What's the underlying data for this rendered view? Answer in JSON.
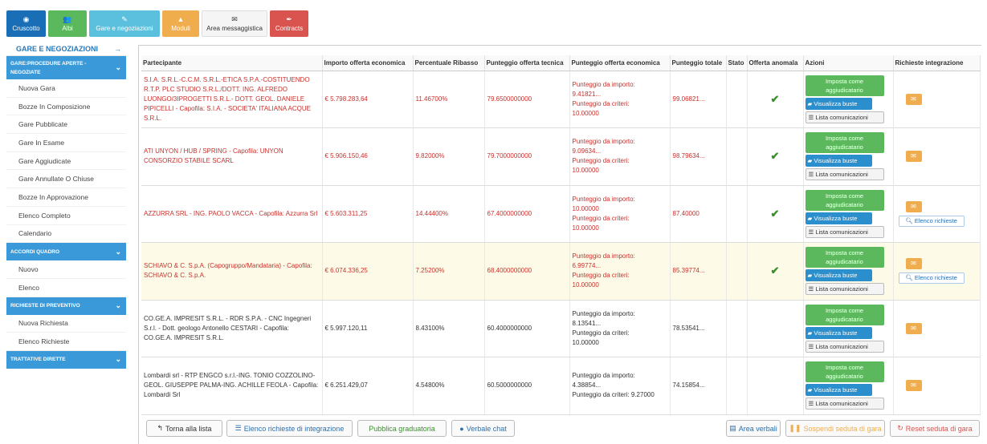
{
  "topnav": [
    {
      "label": "Cruscotto",
      "icon": "dashboard-icon",
      "glyph": "◉"
    },
    {
      "label": "Albi",
      "icon": "users-icon",
      "glyph": "👥"
    },
    {
      "label": "Gare e negoziazioni",
      "icon": "gavel-icon",
      "glyph": "✎"
    },
    {
      "label": "Moduli",
      "icon": "modules-icon",
      "glyph": "▲"
    },
    {
      "label": "Area messaggistica",
      "icon": "envelope-icon",
      "glyph": "✉"
    },
    {
      "label": "Contracts",
      "icon": "pen-icon",
      "glyph": "✒"
    }
  ],
  "sidebar": {
    "header": "GARE E NEGOZIAZIONI",
    "header_arrow": "→",
    "sections": [
      {
        "title": "GARE:PROCEDURE APERTE - NEGOZIATE",
        "items": [
          "Nuova Gara",
          "Bozze In Composizione",
          "Gare Pubblicate",
          "Gare In Esame",
          "Gare Aggiudicate",
          "Gare Annullate O Chiuse",
          "Bozze In Approvazione",
          "Elenco Completo",
          "Calendario"
        ]
      },
      {
        "title": "ACCORDI QUADRO",
        "items": [
          "Nuovo",
          "Elenco"
        ]
      },
      {
        "title": "RICHIESTE DI PREVENTIVO",
        "items": [
          "Nuova Richiesta",
          "Elenco Richieste"
        ]
      },
      {
        "title": "TRATTATIVE DIRETTE",
        "items": []
      }
    ]
  },
  "table": {
    "columns": [
      "Partecipante",
      "Importo offerta economica",
      "Percentuale Ribasso",
      "Punteggio offerta tecnica",
      "Punteggio offerta economica",
      "Punteggio totale",
      "Stato",
      "Offerta anomala",
      "Azioni",
      "Richieste integrazione"
    ],
    "action_labels": {
      "imposta": "Imposta come aggiudicatario",
      "visualizza": "Visualizza buste",
      "lista": "Lista comunicazioni",
      "elenco": "Elenco richieste"
    },
    "rows": [
      {
        "partecipante": "S.I.A. S.R.L.-C.C.M. S.R.L.-ETICA S.P.A.-COSTITUENDO R.T.P. PLC STUDIO S.R.L./DOTT. ING. ALFREDO LUONGO/3IPROGETTI S.R.L.- DOTT. GEOL. DANIELE PIPICELLI - Capofila: S.I.A. - SOCIETA' ITALIANA ACQUE S.R.L.",
        "importo": "€ 5.798.283,64",
        "ribasso": "11.46700%",
        "tecnica": "79.6500000000",
        "economica": [
          "Punteggio da importo:",
          "9.41821...",
          "Punteggio da criteri:",
          "10.00000"
        ],
        "totale": "99.06821...",
        "anomala": "✔",
        "style": "red",
        "elenco": false
      },
      {
        "partecipante": "ATI UNYON / HUB / SPRING - Capofila: UNYON CONSORZIO STABILE SCARL",
        "importo": "€ 5.906.150,46",
        "ribasso": "9.82000%",
        "tecnica": "79.7000000000",
        "economica": [
          "Punteggio da importo:",
          "9.09634...",
          "Punteggio da criteri:",
          "10.00000"
        ],
        "totale": "98.79634...",
        "anomala": "✔",
        "style": "red",
        "elenco": false
      },
      {
        "partecipante": "AZZURRA SRL - ING. PAOLO VACCA - Capofila: Azzurra Srl",
        "importo": "€ 5.603.311,25",
        "ribasso": "14.44400%",
        "tecnica": "67.4000000000",
        "economica": [
          "Punteggio da importo:",
          "10.00000",
          "Punteggio da criteri:",
          "10.00000"
        ],
        "totale": "87.40000",
        "anomala": "✔",
        "style": "red",
        "elenco": true
      },
      {
        "partecipante": "SCHIAVO & C. S.p.A. (Capogruppo/Mandataria) - Capofila: SCHIAVO & C. S.p.A.",
        "importo": "€ 6.074.336,25",
        "ribasso": "7.25200%",
        "tecnica": "68.4000000000",
        "economica": [
          "Punteggio da importo:",
          "6.99774...",
          "Punteggio da criteri:",
          "10.00000"
        ],
        "totale": "85.39774...",
        "anomala": "✔",
        "style": "yellow",
        "elenco": true
      },
      {
        "partecipante": "CO.GE.A. IMPRESIT S.R.L. - RDR S.P.A. - CNC Ingegneri S.r.l. - Dott. geologo Antonello CESTARI - Capofila: CO.GE.A. IMPRESIT S.R.L.",
        "importo": "€ 5.997.120,11",
        "ribasso": "8.43100%",
        "tecnica": "60.4000000000",
        "economica": [
          "Punteggio da importo:",
          "8.13541...",
          "Punteggio da criteri:",
          "10.00000"
        ],
        "totale": "78.53541...",
        "anomala": "",
        "style": "normal",
        "elenco": false
      },
      {
        "partecipante": "Lombardi srl - RTP ENGCO s.r.l.-ING. TONIO COZZOLINO-GEOL. GIUSEPPE PALMA-ING. ACHILLE FEOLA - Capofila: Lombardi Srl",
        "importo": "€ 6.251.429,07",
        "ribasso": "4.54800%",
        "tecnica": "60.5000000000",
        "economica": [
          "Punteggio da importo:",
          "4.38854...",
          "Punteggio da criteri: 9.27000"
        ],
        "totale": "74.15854...",
        "anomala": "",
        "style": "normal",
        "elenco": false
      }
    ]
  },
  "bottombar": {
    "torna": "Torna alla lista",
    "elenco_integrazione": "Elenco richieste di integrazione",
    "pubblica": "Pubblica graduatoria",
    "verbale": "Verbale chat",
    "area_verbali": "Area verbali",
    "sospendi": "Sospendi seduta di gara",
    "reset": "Reset seduta di gara"
  },
  "colors": {
    "primary": "#1a6eb6",
    "success": "#5cb85c",
    "info": "#5bc0de",
    "warning": "#f0ad4e",
    "danger": "#d9534f",
    "sidebar_section": "#3a9ad9",
    "alert_text": "#c9302c"
  }
}
